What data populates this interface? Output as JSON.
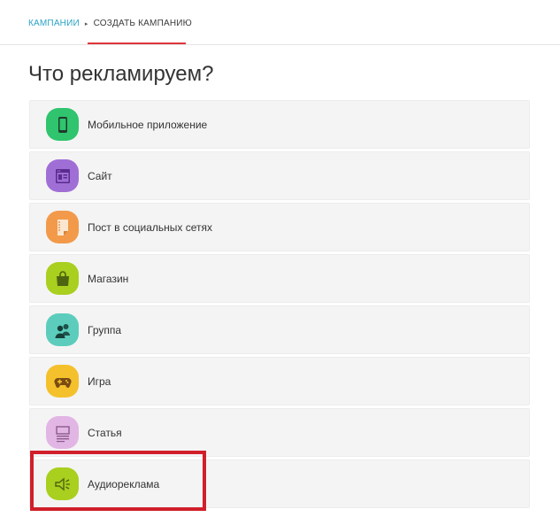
{
  "breadcrumb": {
    "parent": "КАМПАНИИ",
    "separator": "▸",
    "current": "СОЗДАТЬ КАМПАНИЮ"
  },
  "page": {
    "title": "Что рекламируем?"
  },
  "options": [
    {
      "label": "Мобильное приложение",
      "icon": "mobile-phone-icon",
      "color": "#2fc46d"
    },
    {
      "label": "Сайт",
      "icon": "website-icon",
      "color": "#a06fd6"
    },
    {
      "label": "Пост в социальных сетях",
      "icon": "post-note-icon",
      "color": "#f29a4a"
    },
    {
      "label": "Магазин",
      "icon": "shopping-bag-icon",
      "color": "#a9cf1f"
    },
    {
      "label": "Группа",
      "icon": "group-users-icon",
      "color": "#5ccdbd"
    },
    {
      "label": "Игра",
      "icon": "gamepad-icon",
      "color": "#f4c12d"
    },
    {
      "label": "Статья",
      "icon": "article-icon",
      "color": "#e2b6e4"
    },
    {
      "label": "Аудиореклама",
      "icon": "speaker-icon",
      "color": "#a9cf1f"
    }
  ],
  "colors": {
    "link": "#2aa3c6",
    "accent_underline": "#e0353b",
    "highlight_frame": "#d01f2a"
  }
}
